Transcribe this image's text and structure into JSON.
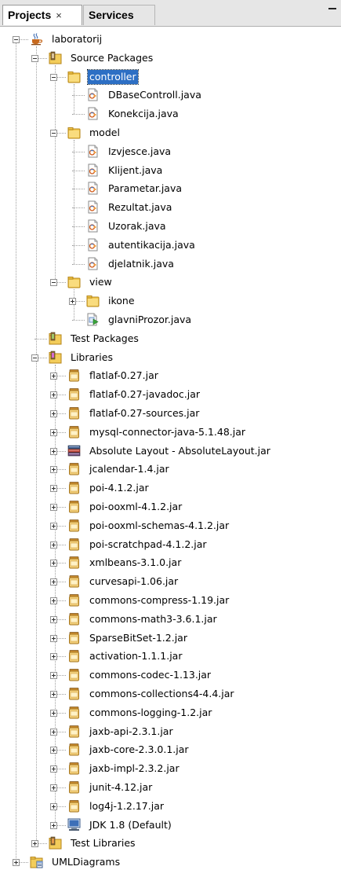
{
  "tabs": [
    {
      "label": "Projects",
      "active": true,
      "close": "×"
    },
    {
      "label": "Services",
      "active": false
    }
  ],
  "tree": [
    {
      "label": "laboratorij",
      "depth": 0,
      "icon": "project-icon",
      "expander": "minus"
    },
    {
      "label": "Source Packages",
      "depth": 1,
      "icon": "source-packages-icon",
      "expander": "minus"
    },
    {
      "label": "controller",
      "depth": 2,
      "icon": "package-icon",
      "expander": "minus",
      "selected": true
    },
    {
      "label": "DBaseControll.java",
      "depth": 3,
      "icon": "java-file-icon"
    },
    {
      "label": "Konekcija.java",
      "depth": 3,
      "icon": "java-file-icon"
    },
    {
      "label": "model",
      "depth": 2,
      "icon": "package-icon",
      "expander": "minus"
    },
    {
      "label": "Izvjesce.java",
      "depth": 3,
      "icon": "java-file-icon"
    },
    {
      "label": "Klijent.java",
      "depth": 3,
      "icon": "java-file-icon"
    },
    {
      "label": "Parametar.java",
      "depth": 3,
      "icon": "java-file-icon"
    },
    {
      "label": "Rezultat.java",
      "depth": 3,
      "icon": "java-file-icon"
    },
    {
      "label": "Uzorak.java",
      "depth": 3,
      "icon": "java-file-icon"
    },
    {
      "label": "autentikacija.java",
      "depth": 3,
      "icon": "java-file-icon"
    },
    {
      "label": "djelatnik.java",
      "depth": 3,
      "icon": "java-file-icon"
    },
    {
      "label": "view",
      "depth": 2,
      "icon": "package-icon",
      "expander": "minus"
    },
    {
      "label": "ikone",
      "depth": 3,
      "icon": "package-icon",
      "expander": "plus"
    },
    {
      "label": "glavniProzor.java",
      "depth": 3,
      "icon": "java-main-icon"
    },
    {
      "label": "Test Packages",
      "depth": 1,
      "icon": "test-packages-icon"
    },
    {
      "label": "Libraries",
      "depth": 1,
      "icon": "libraries-icon",
      "expander": "minus"
    },
    {
      "label": "flatlaf-0.27.jar",
      "depth": 2,
      "icon": "jar-icon",
      "expander": "plus"
    },
    {
      "label": "flatlaf-0.27-javadoc.jar",
      "depth": 2,
      "icon": "jar-icon",
      "expander": "plus"
    },
    {
      "label": "flatlaf-0.27-sources.jar",
      "depth": 2,
      "icon": "jar-icon",
      "expander": "plus"
    },
    {
      "label": "mysql-connector-java-5.1.48.jar",
      "depth": 2,
      "icon": "jar-icon",
      "expander": "plus"
    },
    {
      "label": "Absolute Layout - AbsoluteLayout.jar",
      "depth": 2,
      "icon": "library-books-icon",
      "expander": "plus"
    },
    {
      "label": "jcalendar-1.4.jar",
      "depth": 2,
      "icon": "jar-icon",
      "expander": "plus"
    },
    {
      "label": "poi-4.1.2.jar",
      "depth": 2,
      "icon": "jar-icon",
      "expander": "plus"
    },
    {
      "label": "poi-ooxml-4.1.2.jar",
      "depth": 2,
      "icon": "jar-icon",
      "expander": "plus"
    },
    {
      "label": "poi-ooxml-schemas-4.1.2.jar",
      "depth": 2,
      "icon": "jar-icon",
      "expander": "plus"
    },
    {
      "label": "poi-scratchpad-4.1.2.jar",
      "depth": 2,
      "icon": "jar-icon",
      "expander": "plus"
    },
    {
      "label": "xmlbeans-3.1.0.jar",
      "depth": 2,
      "icon": "jar-icon",
      "expander": "plus"
    },
    {
      "label": "curvesapi-1.06.jar",
      "depth": 2,
      "icon": "jar-icon",
      "expander": "plus"
    },
    {
      "label": "commons-compress-1.19.jar",
      "depth": 2,
      "icon": "jar-icon",
      "expander": "plus"
    },
    {
      "label": "commons-math3-3.6.1.jar",
      "depth": 2,
      "icon": "jar-icon",
      "expander": "plus"
    },
    {
      "label": "SparseBitSet-1.2.jar",
      "depth": 2,
      "icon": "jar-icon",
      "expander": "plus"
    },
    {
      "label": "activation-1.1.1.jar",
      "depth": 2,
      "icon": "jar-icon",
      "expander": "plus"
    },
    {
      "label": "commons-codec-1.13.jar",
      "depth": 2,
      "icon": "jar-icon",
      "expander": "plus"
    },
    {
      "label": "commons-collections4-4.4.jar",
      "depth": 2,
      "icon": "jar-icon",
      "expander": "plus"
    },
    {
      "label": "commons-logging-1.2.jar",
      "depth": 2,
      "icon": "jar-icon",
      "expander": "plus"
    },
    {
      "label": "jaxb-api-2.3.1.jar",
      "depth": 2,
      "icon": "jar-icon",
      "expander": "plus"
    },
    {
      "label": "jaxb-core-2.3.0.1.jar",
      "depth": 2,
      "icon": "jar-icon",
      "expander": "plus"
    },
    {
      "label": "jaxb-impl-2.3.2.jar",
      "depth": 2,
      "icon": "jar-icon",
      "expander": "plus"
    },
    {
      "label": "junit-4.12.jar",
      "depth": 2,
      "icon": "jar-icon",
      "expander": "plus"
    },
    {
      "label": "log4j-1.2.17.jar",
      "depth": 2,
      "icon": "jar-icon",
      "expander": "plus"
    },
    {
      "label": "JDK 1.8 (Default)",
      "depth": 2,
      "icon": "jdk-icon",
      "expander": "plus"
    },
    {
      "label": "Test Libraries",
      "depth": 1,
      "icon": "test-libraries-icon",
      "expander": "plus"
    },
    {
      "label": "UMLDiagrams",
      "depth": 0,
      "icon": "uml-project-icon",
      "expander": "plus"
    }
  ],
  "colors": {
    "selection": "#2d6fc4",
    "folder": "#e8b83a",
    "jar": "#e7b44f",
    "java_file_accent": "#e0732b"
  }
}
